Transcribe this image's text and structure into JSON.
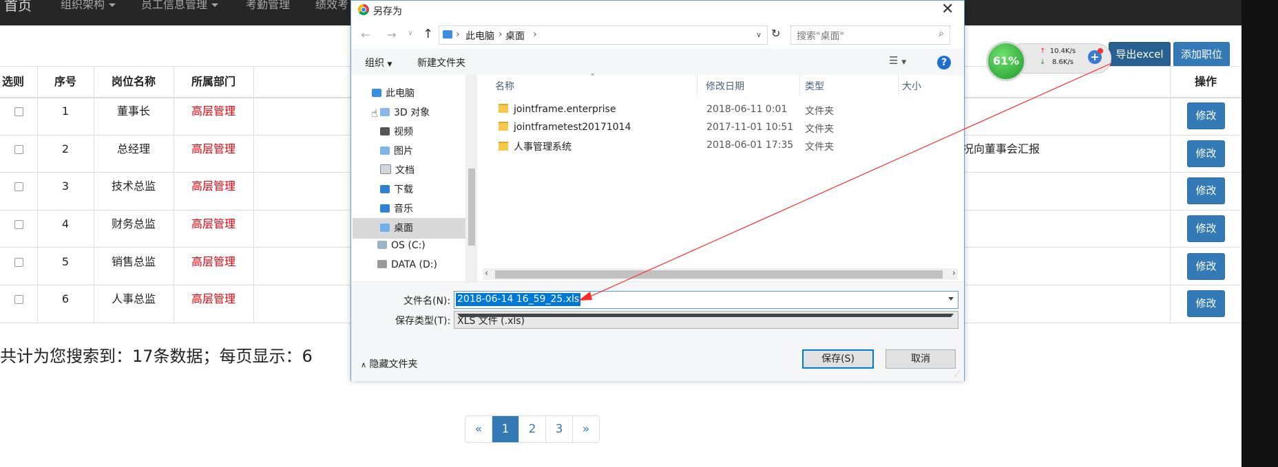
{
  "topnav": {
    "items": [
      "首页",
      "组织架构",
      "员工信息管理",
      "考勤管理",
      "绩效考"
    ]
  },
  "actions": {
    "export_label": "导出excel",
    "add_label": "添加职位"
  },
  "table": {
    "headers": [
      "选则",
      "序号",
      "岗位名称",
      "所属部门",
      "操作"
    ],
    "rows": [
      {
        "no": "1",
        "name": "董事长",
        "dept": "高层管理",
        "desc": ""
      },
      {
        "no": "2",
        "name": "总经理",
        "dept": "高层管理",
        "desc": "况向董事会汇报"
      },
      {
        "no": "3",
        "name": "技术总监",
        "dept": "高层管理",
        "desc": ""
      },
      {
        "no": "4",
        "name": "财务总监",
        "dept": "高层管理",
        "desc": ""
      },
      {
        "no": "5",
        "name": "销售总监",
        "dept": "高层管理",
        "desc": ""
      },
      {
        "no": "6",
        "name": "人事总监",
        "dept": "高层管理",
        "desc": ""
      }
    ],
    "edit_label": "修改"
  },
  "summary": "共计为您搜索到：17条数据；每页显示：6",
  "pagination": {
    "prev": "«",
    "pages": [
      "1",
      "2",
      "3"
    ],
    "next": "»",
    "active": "1"
  },
  "net_monitor": {
    "percent": "61%",
    "up": "10.4K/s",
    "down": "8.6K/s"
  },
  "dialog": {
    "title": "另存为",
    "breadcrumb": [
      "此电脑",
      "桌面"
    ],
    "search_placeholder": "搜索\"桌面\"",
    "toolbar": {
      "organize": "组织",
      "new_folder": "新建文件夹"
    },
    "tree": [
      "此电脑",
      "3D 对象",
      "视频",
      "图片",
      "文档",
      "下载",
      "音乐",
      "桌面",
      "OS (C:)",
      "DATA (D:)"
    ],
    "columns": [
      "名称",
      "修改日期",
      "类型",
      "大小"
    ],
    "files": [
      {
        "name": "jointframe.enterprise",
        "date": "2018-06-11 0:01",
        "type": "文件夹"
      },
      {
        "name": "jointframetest20171014",
        "date": "2017-11-01 10:51",
        "type": "文件夹"
      },
      {
        "name": "人事管理系统",
        "date": "2018-06-01 17:35",
        "type": "文件夹"
      }
    ],
    "filename_label": "文件名(N):",
    "filename_value": "2018-06-14 16_59_25.xls",
    "filetype_label": "保存类型(T):",
    "filetype_value": "XLS 文件 (.xls)",
    "hide_folders": "隐藏文件夹",
    "save": "保存(S)",
    "cancel": "取消"
  },
  "colors": {
    "accent": "#337ab7",
    "dept_red": "#e8000b",
    "selection": "#0078d7",
    "arrow": "#ff2a2a"
  }
}
